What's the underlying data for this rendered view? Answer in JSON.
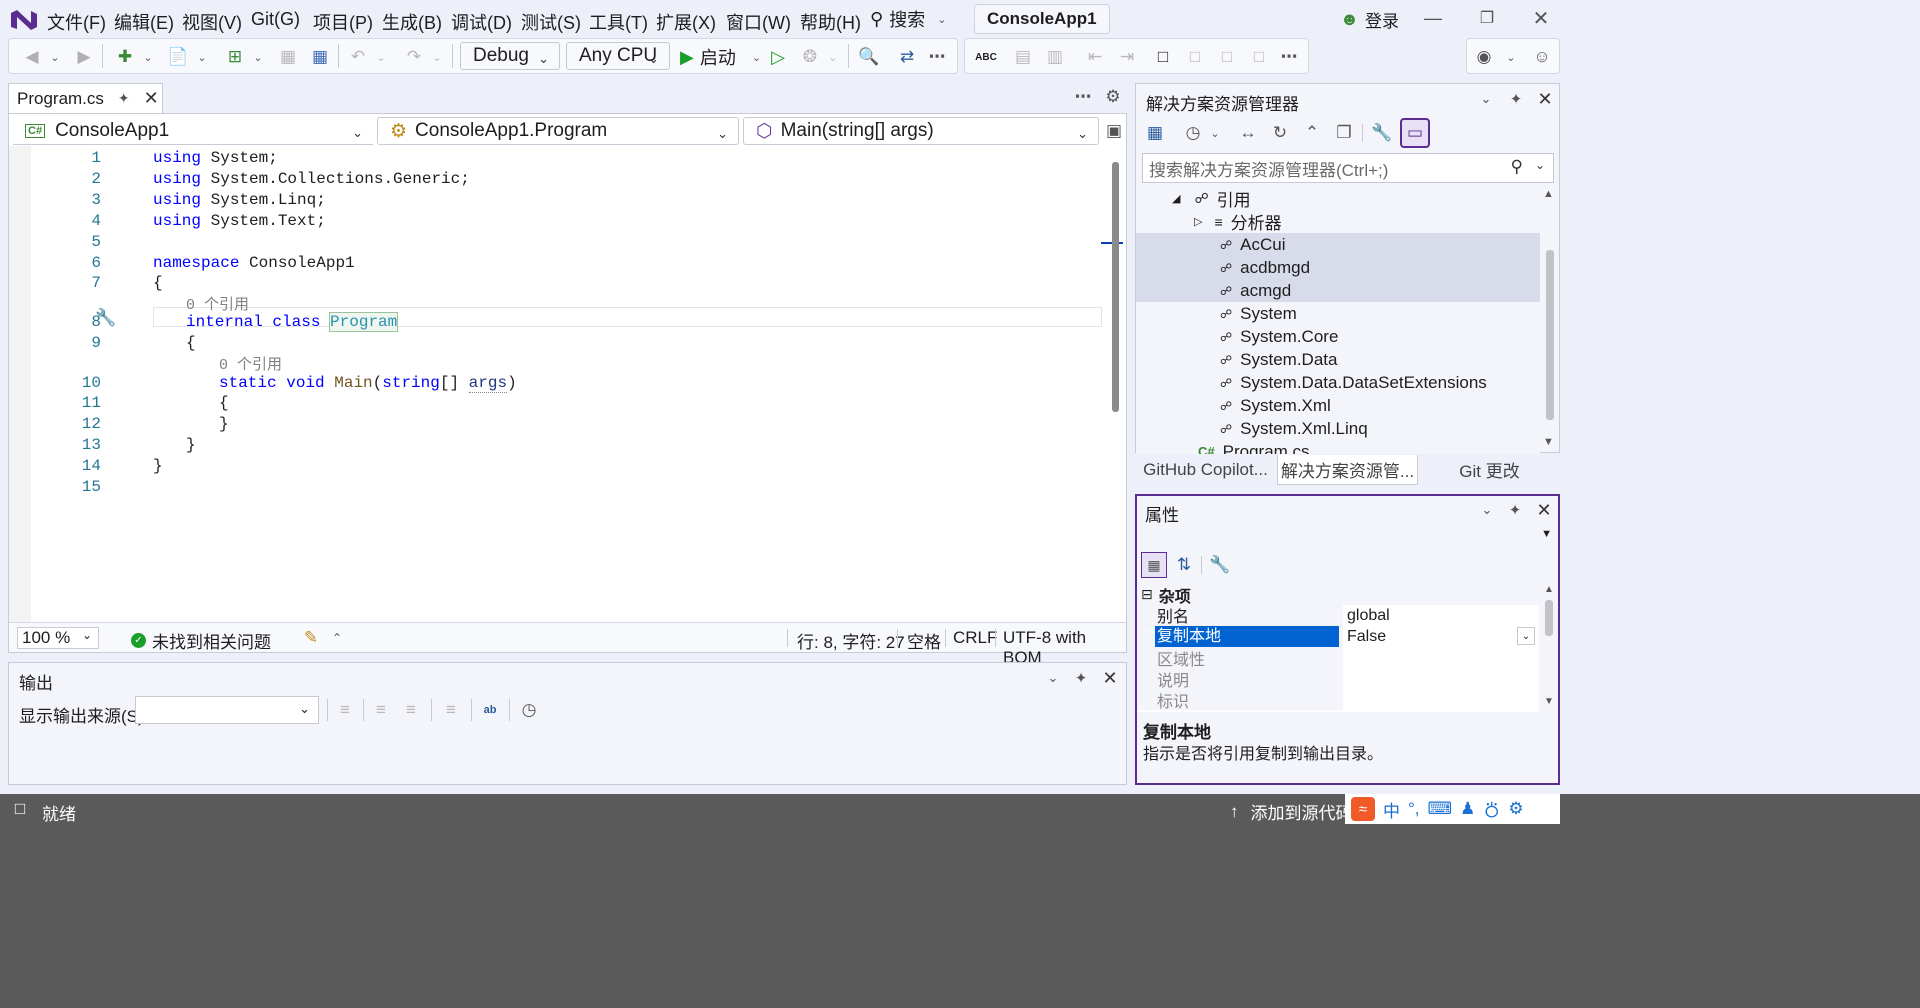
{
  "titlebar": {
    "menus": [
      "文件(F)",
      "编辑(E)",
      "视图(V)",
      "Git(G)",
      "项目(P)",
      "生成(B)",
      "调试(D)",
      "测试(S)",
      "工具(T)",
      "扩展(X)",
      "窗口(W)",
      "帮助(H)"
    ],
    "search_label": "搜索",
    "solution_name": "ConsoleApp1",
    "login_label": "登录"
  },
  "toolbar": {
    "config": "Debug",
    "platform": "Any CPU",
    "start_label": "启动"
  },
  "editor": {
    "tab_label": "Program.cs",
    "project_combo": "ConsoleApp1",
    "type_combo": "ConsoleApp1.Program",
    "member_combo": "Main(string[] args)",
    "lines": [
      "using System;",
      "using System.Collections.Generic;",
      "using System.Linq;",
      "using System.Text;",
      "",
      "namespace ConsoleApp1",
      "{",
      "internal class Program",
      "{",
      "static void Main(string[] args)",
      "{",
      "}",
      "}",
      "}",
      ""
    ],
    "refs_hint_class": "0 个引用",
    "refs_hint_method": "0 个引用",
    "zoom": "100 %",
    "issues": "未找到相关问题",
    "position": "行: 8, 字符: 27",
    "indent": "空格",
    "line_ending": "CRLF",
    "encoding": "UTF-8 with BOM"
  },
  "output": {
    "title": "输出",
    "source_label": "显示输出来源(S):",
    "source_value": ""
  },
  "solution_explorer": {
    "title": "解决方案资源管理器",
    "search_placeholder": "搜索解决方案资源管理器(Ctrl+;)",
    "references_label": "引用",
    "analyzers_label": "分析器",
    "items": [
      "AcCui",
      "acdbmgd",
      "acmgd",
      "System",
      "System.Core",
      "System.Data",
      "System.Data.DataSetExtensions",
      "System.Xml",
      "System.Xml.Linq"
    ],
    "file_label": "Program.cs",
    "tabs": [
      "GitHub Copilot...",
      "解决方案资源管...",
      "Git 更改"
    ]
  },
  "properties": {
    "title": "属性",
    "category": "杂项",
    "rows": [
      {
        "name": "别名",
        "value": "global"
      },
      {
        "name": "复制本地",
        "value": "False"
      },
      {
        "name": "区域性",
        "value": ""
      },
      {
        "name": "说明",
        "value": ""
      },
      {
        "name": "标识",
        "value": ""
      }
    ],
    "desc_title": "复制本地",
    "desc_text": "指示是否将引用复制到输出目录。"
  },
  "statusbar": {
    "ready": "就绪",
    "add_source": "添加到源代码",
    "ime_lang": "中"
  },
  "colors": {
    "accent": "#5c2d91",
    "selection": "#0063d1",
    "tree_highlight": "#d8dcea",
    "statusbar": "#5a5a5a",
    "keyword": "#0000ff",
    "type": "#2b91af"
  }
}
